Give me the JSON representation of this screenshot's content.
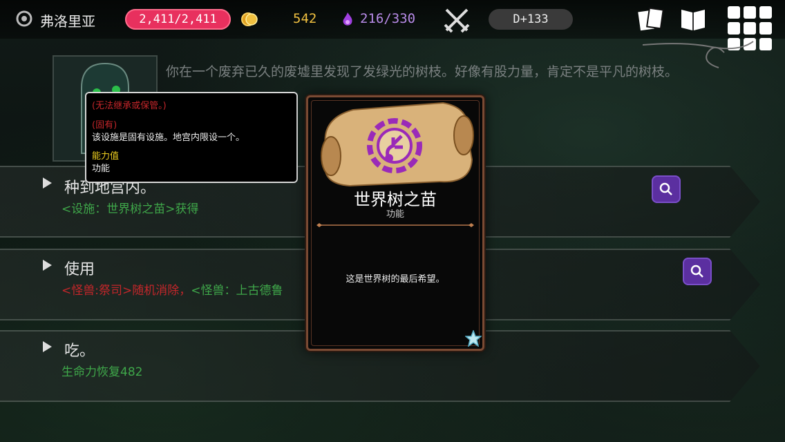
{
  "header": {
    "player_name": "弗洛里亚",
    "hp": "2,411/2,411",
    "gold": "542",
    "mana": "216/330",
    "day": "D+133"
  },
  "event": {
    "description": "你在一个废弃已久的废墟里发现了发绿光的树枝。好像有股力量，肯定不是平凡的树枝。",
    "options": [
      {
        "title": "种到地宫内。",
        "result": "<设施：世界树之苗>获得"
      },
      {
        "title": "使用",
        "result_red": "<怪兽:祭司>随机消除，",
        "result_green": "<怪兽：上古德鲁"
      },
      {
        "title": "吃。",
        "result": "生命力恢复482"
      }
    ]
  },
  "tooltip": {
    "restriction": "(无法继承或保管。)",
    "unique_tag": "(固有)",
    "unique_desc": "该设施是固有设施。地宫内限设一个。",
    "ability_label": "能力值",
    "ability_value": "功能"
  },
  "card": {
    "title": "世界树之苗",
    "subtitle": "功能",
    "description": "这是世界树的最后希望。"
  },
  "colors": {
    "hp_pill": "#e8305e",
    "gold_text": "#f0c040",
    "mana_text": "#b88be8",
    "result_green": "#3fa84a",
    "result_red": "#c4262a",
    "search_button": "#5b2fa0",
    "card_frame": "#7a4a33"
  },
  "icons": [
    "gear-emblem-icon",
    "coin-icon",
    "mana-flame-icon",
    "crossed-swords-icon",
    "cards-icon",
    "book-icon",
    "menu-grid-icon",
    "search-icon",
    "star-icon"
  ]
}
